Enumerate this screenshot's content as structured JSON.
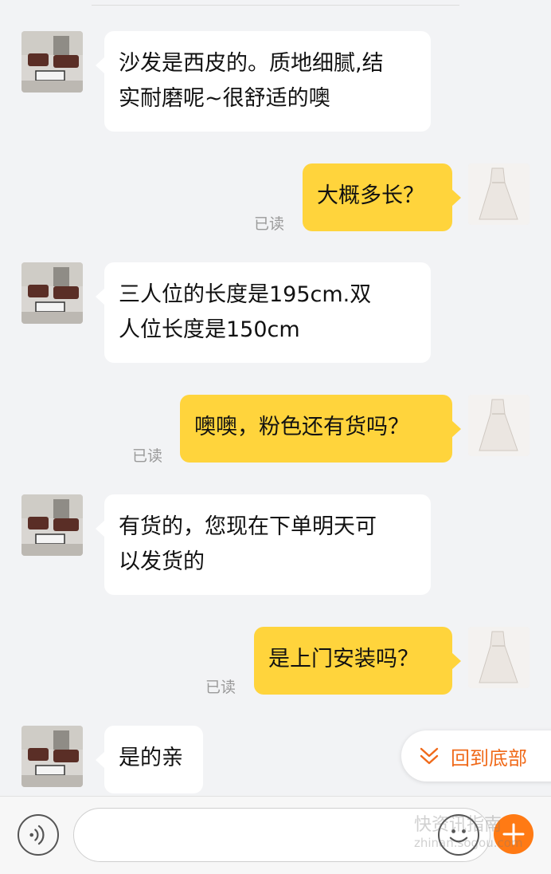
{
  "messages": [
    {
      "side": "left",
      "text": "沙发是西皮的。质地细腻,结实耐磨呢~很舒适的噢",
      "line1": "沙发是西皮的。质地细腻,结",
      "line2": "实耐磨呢~很舒适的噢"
    },
    {
      "side": "right",
      "text": "大概多长？",
      "read": "已读"
    },
    {
      "side": "left",
      "text": "三人位的长度是195cm.双人位长度是150cm",
      "line1": "三人位的长度是195cm.双",
      "line2": "人位长度是150cm"
    },
    {
      "side": "right",
      "text": "噢噢，粉色还有货吗？",
      "read": "已读"
    },
    {
      "side": "left",
      "text": "有货的，您现在下单明天可以发货的",
      "line1": "有货的，您现在下单明天可",
      "line2": "以发货的"
    },
    {
      "side": "right",
      "text": "是上门安装吗？",
      "read": "已读"
    },
    {
      "side": "left",
      "text": "是的亲"
    }
  ],
  "scroll_to_bottom": {
    "label": "回到底部",
    "icon": "double-chevron-down-icon"
  },
  "input": {
    "value": "",
    "placeholder": ""
  },
  "icons": {
    "voice": "voice-icon",
    "emoji": "emoji-icon",
    "plus": "plus-icon"
  },
  "watermark": {
    "line1": "快资讯指南",
    "line2": "zhinan.sogou.com"
  },
  "colors": {
    "bubble_right": "#ffd43c",
    "bubble_left": "#ffffff",
    "accent": "#f06a1a",
    "background": "#f2f3f5"
  }
}
